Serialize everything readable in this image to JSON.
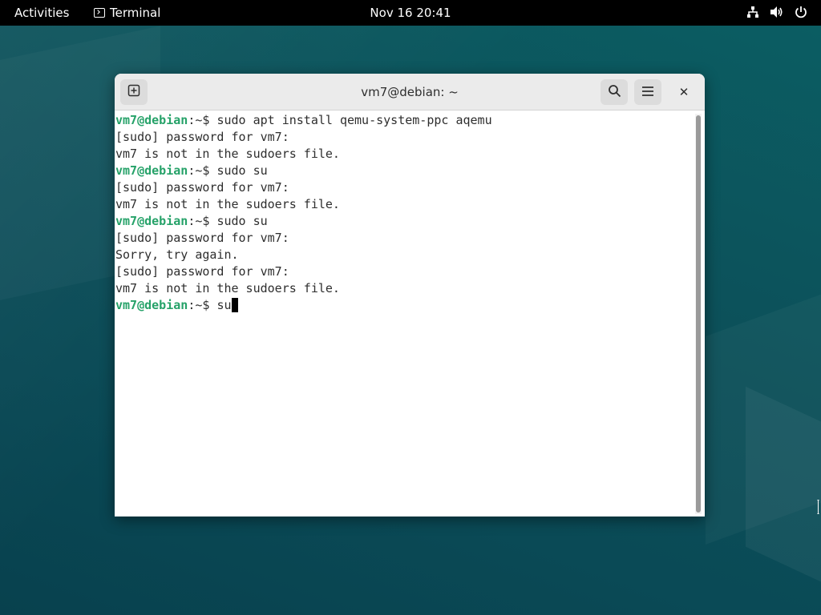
{
  "topbar": {
    "activities_label": "Activities",
    "app_label": "Terminal",
    "app_icon": "terminal-icon",
    "clock": "Nov 16  20:41",
    "tray_icons": [
      "network-icon",
      "volume-icon",
      "power-icon"
    ]
  },
  "window": {
    "title": "vm7@debian: ~",
    "new_tab_icon": "new-tab-icon",
    "search_icon": "search-icon",
    "menu_icon": "hamburger-menu-icon",
    "close_label": "✕"
  },
  "terminal": {
    "prompt_user": "vm7@debian",
    "prompt_path": ":~$ ",
    "lines": [
      {
        "type": "prompt",
        "cmd": "sudo apt install qemu-system-ppc aqemu"
      },
      {
        "type": "output",
        "text": "[sudo] password for vm7:"
      },
      {
        "type": "output",
        "text": "vm7 is not in the sudoers file."
      },
      {
        "type": "prompt",
        "cmd": "sudo su"
      },
      {
        "type": "output",
        "text": "[sudo] password for vm7:"
      },
      {
        "type": "output",
        "text": "vm7 is not in the sudoers file."
      },
      {
        "type": "prompt",
        "cmd": "sudo su"
      },
      {
        "type": "output",
        "text": "[sudo] password for vm7:"
      },
      {
        "type": "output",
        "text": "Sorry, try again."
      },
      {
        "type": "output",
        "text": "[sudo] password for vm7:"
      },
      {
        "type": "output",
        "text": "vm7 is not in the sudoers file."
      },
      {
        "type": "prompt",
        "cmd": "su",
        "cursor": true
      }
    ]
  },
  "colors": {
    "prompt_user": "#26a269",
    "text": "#2e2e2e",
    "topbar": "#000000"
  }
}
